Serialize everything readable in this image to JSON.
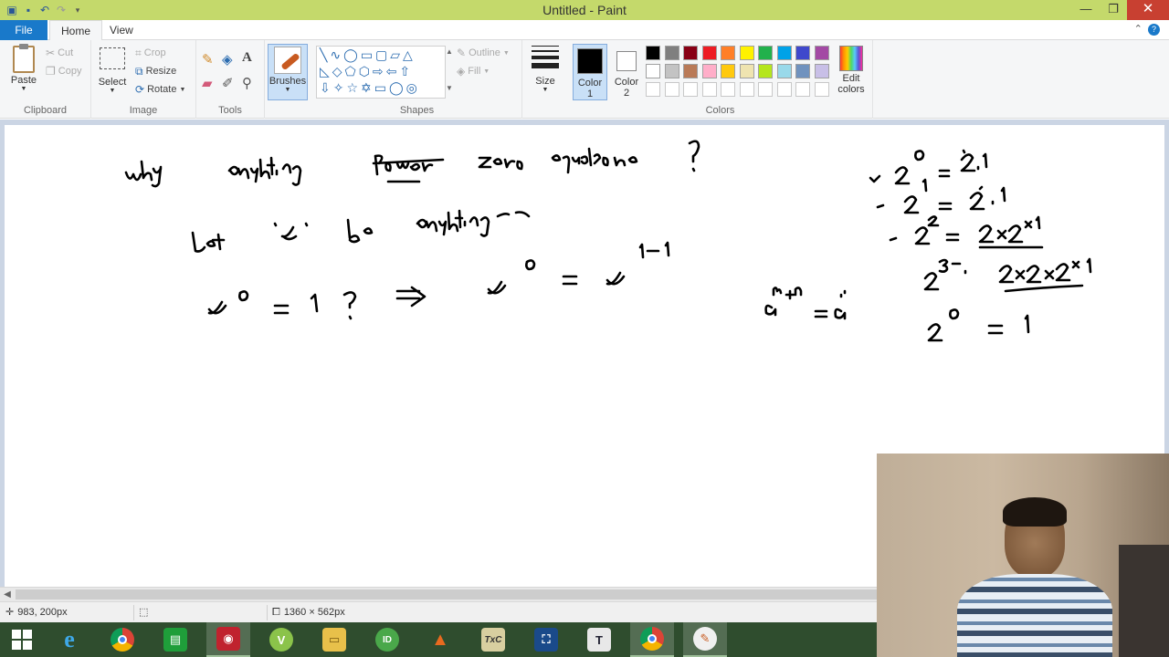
{
  "window": {
    "title": "Untitled - Paint"
  },
  "tabs": {
    "file": "File",
    "home": "Home",
    "view": "View"
  },
  "ribbon": {
    "clipboard": {
      "title": "Clipboard",
      "paste": "Paste",
      "cut": "Cut",
      "copy": "Copy"
    },
    "image": {
      "title": "Image",
      "select": "Select",
      "crop": "Crop",
      "resize": "Resize",
      "rotate": "Rotate"
    },
    "tools": {
      "title": "Tools"
    },
    "brushes": {
      "label": "Brushes"
    },
    "shapes": {
      "title": "Shapes",
      "outline": "Outline",
      "fill": "Fill"
    },
    "size": {
      "label": "Size"
    },
    "colors": {
      "title": "Colors",
      "color1": "Color",
      "color1_num": "1",
      "color2": "Color",
      "color2_num": "2",
      "edit": "Edit",
      "edit2": "colors",
      "row1": [
        "#000000",
        "#7f7f7f",
        "#880015",
        "#ed1c24",
        "#ff7f27",
        "#fff200",
        "#22b14c",
        "#00a2e8",
        "#3f48cc",
        "#a349a4"
      ],
      "row2": [
        "#ffffff",
        "#c3c3c3",
        "#b97a57",
        "#ffaec9",
        "#ffc90e",
        "#efe4b0",
        "#b5e61d",
        "#99d9ea",
        "#7092be",
        "#c8bfe7"
      ]
    }
  },
  "status": {
    "cursor": "983, 200px",
    "canvas_size": "1360 × 562px"
  }
}
